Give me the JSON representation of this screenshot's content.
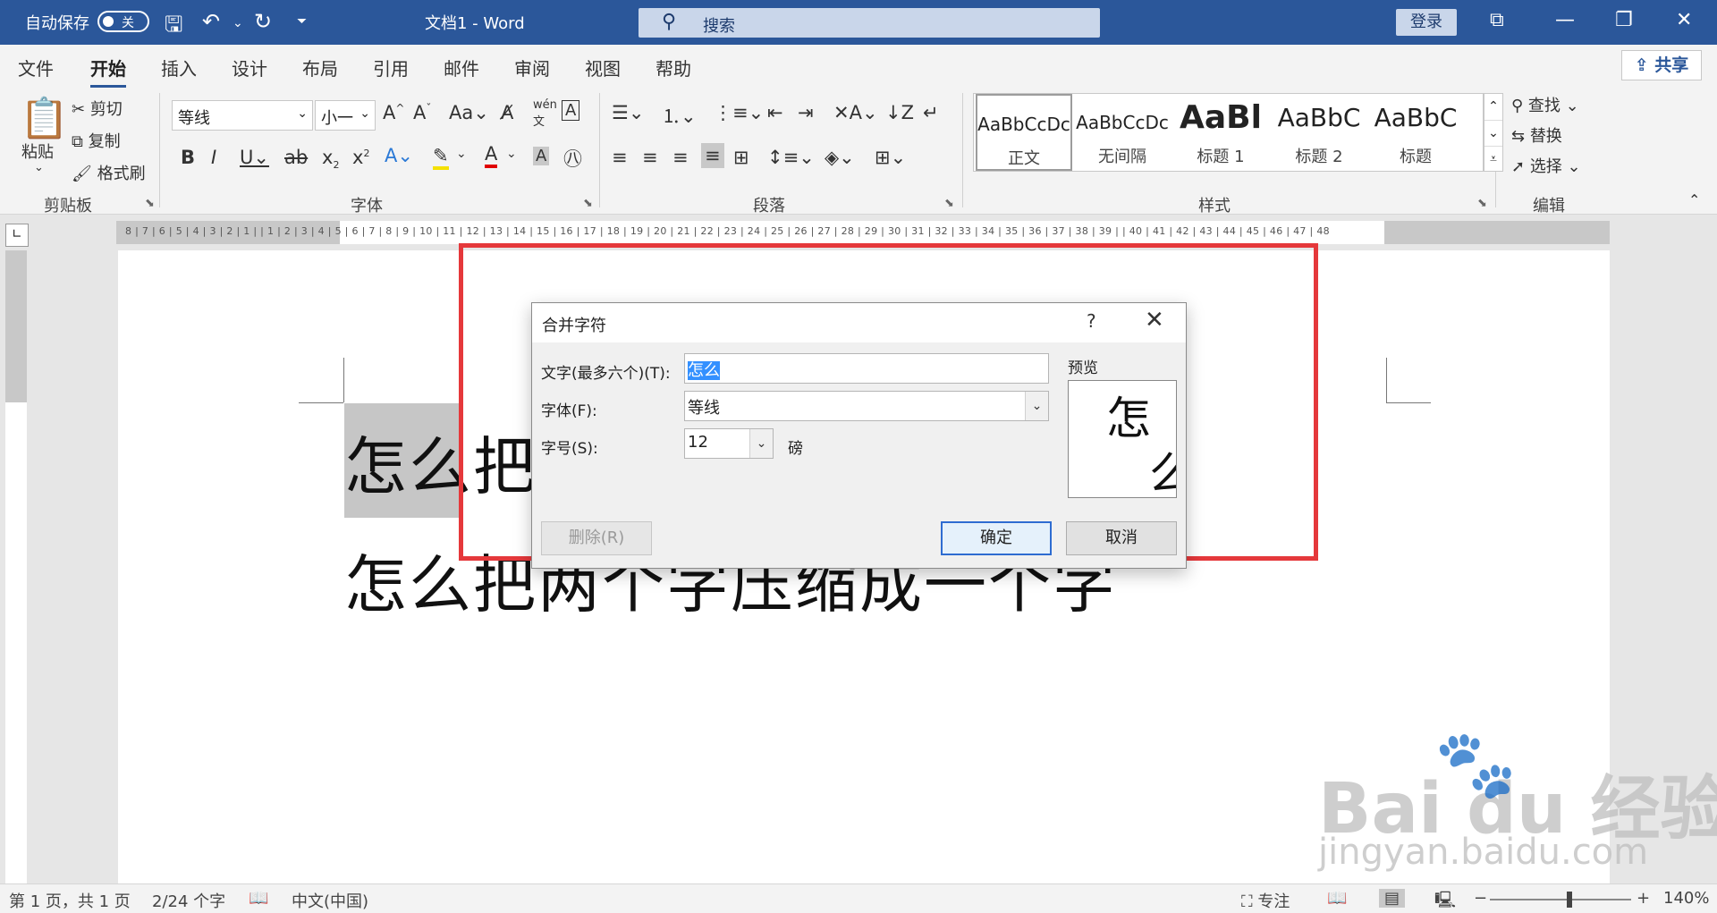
{
  "titlebar": {
    "autosave_label": "自动保存",
    "autosave_state": "关",
    "doc_title": "文档1  -  Word",
    "search_placeholder": "搜索",
    "login_label": "登录"
  },
  "menu": {
    "tabs": [
      "文件",
      "开始",
      "插入",
      "设计",
      "布局",
      "引用",
      "邮件",
      "审阅",
      "视图",
      "帮助"
    ],
    "active_tab": "开始",
    "share_label": "共享"
  },
  "ribbon": {
    "clipboard": {
      "paste": "粘贴",
      "cut": "剪切",
      "copy": "复制",
      "format_painter": "格式刷",
      "group_label": "剪贴板"
    },
    "font": {
      "font_name": "等线",
      "font_size": "小一",
      "group_label": "字体"
    },
    "paragraph": {
      "group_label": "段落"
    },
    "styles": {
      "items": [
        {
          "preview": "AaBbCcDc",
          "name": "正文"
        },
        {
          "preview": "AaBbCcDc",
          "name": "无间隔"
        },
        {
          "preview": "AaBl",
          "name": "标题 1"
        },
        {
          "preview": "AaBbC",
          "name": "标题 2"
        },
        {
          "preview": "AaBbC",
          "name": "标题"
        }
      ],
      "group_label": "样式"
    },
    "editing": {
      "find": "查找",
      "replace": "替换",
      "select": "选择",
      "group_label": "编辑"
    }
  },
  "document": {
    "line1": "怎么把两个字压缩成一个字",
    "line2": "怎么把两个字压缩成一个字"
  },
  "dialog": {
    "title": "合并字符",
    "help": "?",
    "text_label": "文字(最多六个)(T):",
    "text_value": "怎么",
    "font_label": "字体(F):",
    "font_value": "等线",
    "size_label": "字号(S):",
    "size_value": "12",
    "size_unit": "磅",
    "preview_label": "预览",
    "preview_char1": "怎",
    "preview_char2": "么",
    "delete_button": "删除(R)",
    "ok_button": "确定",
    "cancel_button": "取消"
  },
  "statusbar": {
    "page_info": "第 1 页，共 1 页",
    "word_count": "2/24 个字",
    "language": "中文(中国)",
    "focus": "专注",
    "zoom": "140%"
  },
  "ruler_numbers": "8 | 7 | 6 | 5 | 4 | 3 | 2 | 1 |   | 1 | 2 | 3 | 4 | 5 | 6 | 7 | 8 | 9 | 10 | 11 | 12 | 13 | 14 | 15 | 16 | 17 | 18 | 19 | 20 | 21 | 22 | 23 | 24 | 25 | 26 | 27 | 28 | 29 | 30 | 31 | 32 | 33 | 34 | 35 | 36 | 37 | 38 | 39 |   | 40 | 41 | 42 | 43 | 44 | 45 | 46 | 47 | 48",
  "watermark": {
    "brand": "Bai du 经验",
    "url": "jingyan.baidu.com"
  },
  "colors": {
    "title_bar": "#2b579a",
    "highlight_box": "#e5383b",
    "selection": "#3390ff"
  }
}
